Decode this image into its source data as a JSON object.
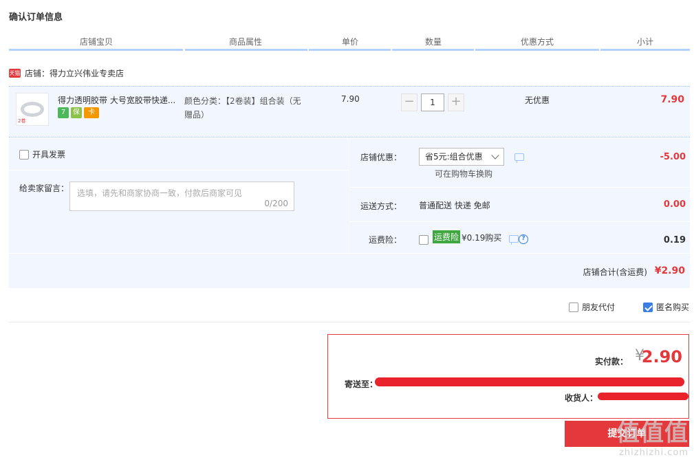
{
  "page_title": "确认订单信息",
  "columns": [
    "店铺宝贝",
    "商品属性",
    "单价",
    "数量",
    "优惠方式",
    "小计"
  ],
  "shop": {
    "badge": "天猫",
    "name": "店铺：得力立兴伟业专卖店"
  },
  "item": {
    "title": "得力透明胶带 大号宽胶带快递...",
    "thumb_label": "2卷",
    "service_icons": [
      "7",
      "保",
      "卡"
    ],
    "attribute": "颜色分类：【2卷装】组合装（无赠品）",
    "unit_price": "7.90",
    "quantity": "1",
    "qty_minus": "−",
    "qty_plus": "+",
    "promotion": "无优惠",
    "subtotal": "7.90"
  },
  "invoice": {
    "label": "开具发票",
    "checked": false
  },
  "message": {
    "label": "给卖家留言：",
    "placeholder": "选填，请先和商家协商一致，付款后商家可见",
    "counter": "0/200"
  },
  "shop_discount": {
    "label": "店铺优惠：",
    "selected": "省5元:组合优惠",
    "note": "可在购物车换购",
    "amount": "-5.00"
  },
  "shipping": {
    "label": "运送方式：",
    "method": "普通配送 快递 免邮",
    "amount": "0.00"
  },
  "insurance": {
    "label": "运费险：",
    "tag": "运费险",
    "price_text": "¥0.19购买",
    "help": "?",
    "amount": "0.19",
    "checked": false
  },
  "shop_total": {
    "label": "店铺合计(含运费)",
    "value": "¥2.90"
  },
  "options": {
    "friend_pay": {
      "label": "朋友代付",
      "checked": false
    },
    "anonymous": {
      "label": "匿名购买",
      "checked": true
    }
  },
  "summary": {
    "pay_label": "实付款：",
    "currency": "¥",
    "pay_value": "2.90",
    "ship_to_label": "寄送至：",
    "receiver_label": "收货人："
  },
  "submit_label": "提交订单",
  "watermark": {
    "main": "值值值",
    "sub": "zhizhizhi.com"
  },
  "colors": {
    "accent_red": "#e4393c",
    "header_blue_line": "#b2d1ff",
    "row_bg": "#f2f7ff",
    "checkbox_blue": "#3a7ee6",
    "insurance_green": "#3fa73f"
  }
}
